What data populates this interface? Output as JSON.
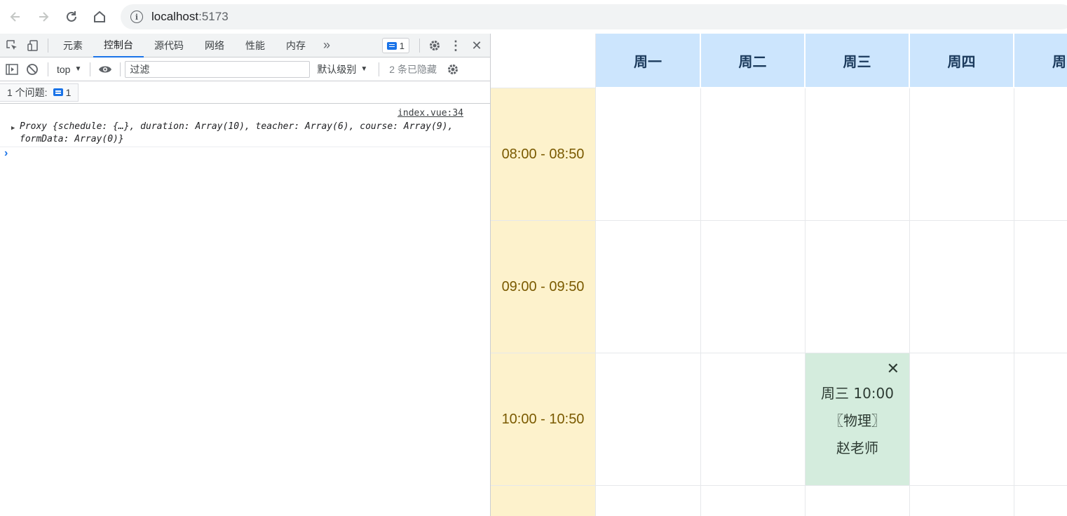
{
  "browser": {
    "url_host": "localhost",
    "url_port": ":5173"
  },
  "devtools": {
    "tabs": [
      "元素",
      "控制台",
      "源代码",
      "网络",
      "性能",
      "内存"
    ],
    "active_tab": "控制台",
    "issue_badge_count": "1",
    "context": "top",
    "filter_placeholder": "过滤",
    "levels_label": "默认级别",
    "hidden_count": "2 条已隐藏",
    "issues_label": "1 个问题:",
    "issues_count": "1",
    "message": {
      "source": "index.vue:34",
      "text": "Proxy {schedule: {…}, duration: Array(10), teacher: Array(6), course: Array(9), formData: Array(0)}"
    }
  },
  "timetable": {
    "days": [
      "周一",
      "周二",
      "周三",
      "周四",
      "周"
    ],
    "times": [
      "08:00 - 08:50",
      "09:00 - 09:50",
      "10:00 - 10:50"
    ],
    "card": {
      "line1": "周三 10:00",
      "line2": "〖物理〗",
      "line3": "赵老师",
      "close": "✕"
    }
  },
  "colors": {
    "header_bg": "#cce5fd",
    "time_bg": "#fdf2cc",
    "card_bg": "#d4ecdd",
    "accent": "#1a73e8"
  }
}
